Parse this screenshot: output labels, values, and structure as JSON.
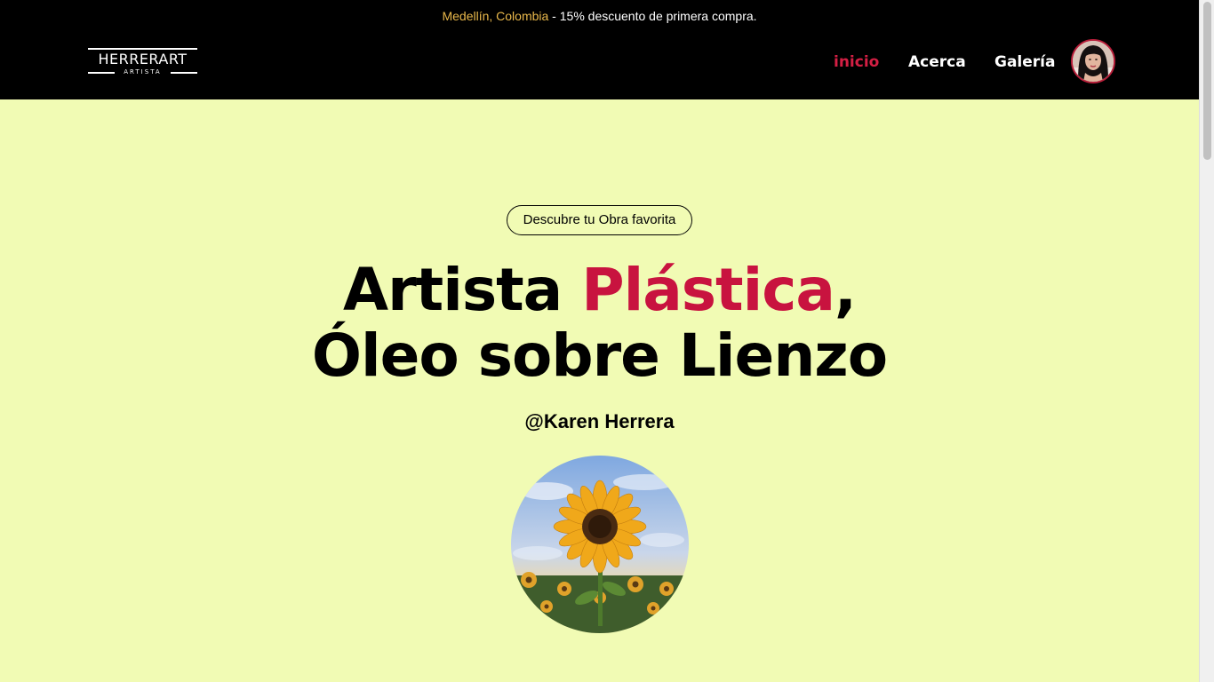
{
  "promo": {
    "city": "Medellín, Colombia",
    "separator": " - ",
    "message": "15% descuento de primera compra."
  },
  "brand": {
    "name": "HERRERART",
    "tagline": "ARTISTA"
  },
  "nav": {
    "items": [
      {
        "label": "inicio",
        "active": true
      },
      {
        "label": "Acerca",
        "active": false
      },
      {
        "label": "Galería",
        "active": false
      }
    ]
  },
  "hero": {
    "pill_label": "Descubre tu Obra favorita",
    "headline_line1_a": "Artista ",
    "headline_line1_accent": "Plástica",
    "headline_line1_b": ",",
    "headline_line2": "Óleo sobre Lienzo",
    "handle": "@Karen Herrera"
  },
  "colors": {
    "background": "#f1fbb4",
    "header": "#000000",
    "accent": "#c8133f",
    "nav_active": "#d41f44",
    "city": "#e9b84b"
  },
  "icons": {
    "avatar": "profile-photo",
    "hero_image": "sunflower-photo"
  }
}
